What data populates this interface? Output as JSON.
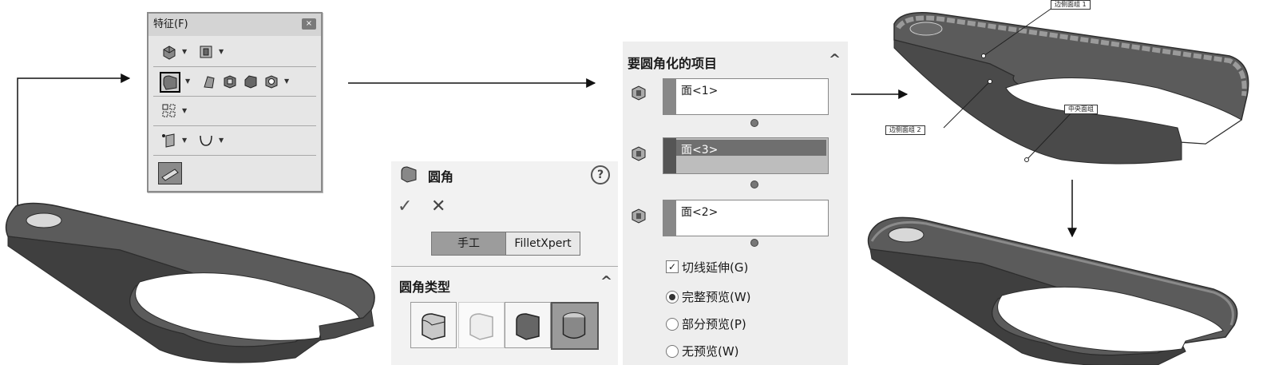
{
  "feature_toolbar": {
    "title": "特征(F)",
    "close": "×"
  },
  "fillet_panel": {
    "title": "圆角",
    "help": "?",
    "ok": "✓",
    "cancel": "✕",
    "mode_manual": "手工",
    "mode_expert": "FilletXpert",
    "section_type": "圆角类型",
    "collapse": "^"
  },
  "items_panel": {
    "section_title": "要圆角化的项目",
    "collapse": "^",
    "face_sets": [
      {
        "label": "面<1>"
      },
      {
        "label": "面<3>"
      },
      {
        "label": "面<2>"
      }
    ],
    "tangent_propagation": "切线延伸(G)",
    "tangent_checked": true,
    "preview_options": [
      {
        "label": "完整预览(W)",
        "selected": true
      },
      {
        "label": "部分预览(P)",
        "selected": false
      },
      {
        "label": "无预览(W)",
        "selected": false
      }
    ]
  },
  "callouts": {
    "side_face_1": "边侧面组 1",
    "side_face_2": "边侧面组 2",
    "center_face": "中央面组"
  },
  "colors": {
    "part_dark": "#5b5b5b",
    "part_edge": "#3a3a3a",
    "panel_bg": "#eeeeee"
  }
}
